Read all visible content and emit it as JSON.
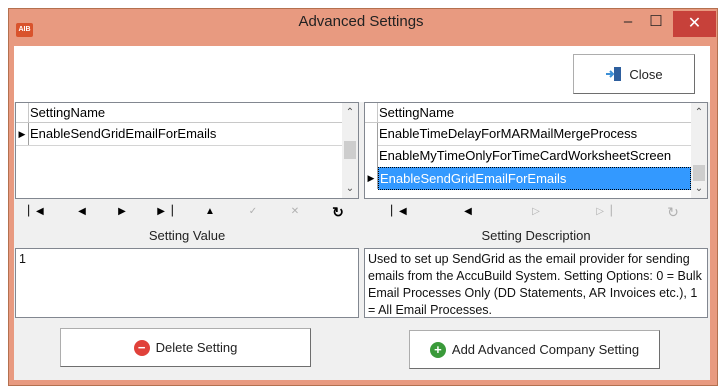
{
  "window": {
    "title": "Advanced Settings",
    "app_icon_text": "AIB",
    "minimize_glyph": "–",
    "maximize_glyph": "☐",
    "close_glyph": "✕"
  },
  "toolbar": {
    "close_label": "Close"
  },
  "left": {
    "column_header": "SettingName",
    "rows": [
      "EnableSendGridEmailForEmails"
    ],
    "value_label": "Setting Value",
    "value_text": "1",
    "delete_label": "Delete Setting"
  },
  "right": {
    "column_header": "SettingName",
    "rows": [
      "EnableTimeDelayForMARMailMergeProcess",
      "EnableMyTimeOnlyForTimeCardWorksheetScreen",
      "EnableSendGridEmailForEmails"
    ],
    "selected_index": 2,
    "description_label": "Setting Description",
    "description_text": "Used to set up SendGrid as the email provider for sending emails from the AccuBuild System. Setting Options: 0 = Bulk Email Processes Only (DD Statements, AR Invoices etc.), 1 = All Email Processes.",
    "add_label": "Add Advanced Company Setting"
  },
  "colors": {
    "selection": "#3399ff",
    "titlebar": "#e89a80",
    "close": "#c7413a",
    "delete_icon": "#e0413a",
    "add_icon": "#3a9a3a"
  }
}
